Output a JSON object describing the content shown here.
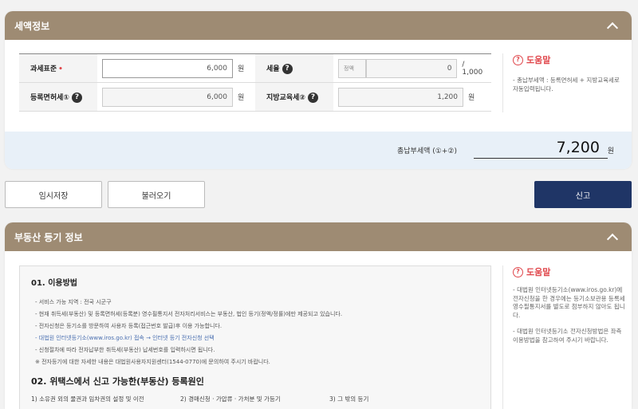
{
  "tax_panel": {
    "title": "세액정보",
    "rows": {
      "base_label": "과세표준",
      "base_required": "•",
      "base_value": "6,000",
      "base_unit": "원",
      "rate_label": "세율",
      "rate_prefix": "정액",
      "rate_value": "0",
      "rate_suffix": "/ 1,000",
      "reg_label": "등록면허세①",
      "reg_value": "6,000",
      "reg_unit": "원",
      "local_label": "지방교육세②",
      "local_value": "1,200",
      "local_unit": "원"
    },
    "help": {
      "title": "도움말",
      "text": "- 총납부세액 : 등록면허세 + 지방교육세로 자동입력됩니다."
    },
    "total": {
      "label": "총납부세액 (①+②)",
      "value": "7,200",
      "unit": "원"
    }
  },
  "actions": {
    "temp_save": "임시저장",
    "load": "불러오기",
    "submit": "신고"
  },
  "property_panel": {
    "title": "부동산 등기 정보",
    "section1_title": "01. 이용방법",
    "lines": [
      "- 서비스 가능 지역 : 전국 시군구",
      "- 현재 취득세(부동산) 및 등록면허세(등록분) 영수필통지서 전자처리서비스는 부동산, 법인 등기(정액/정률)에만 제공되고 있습니다.",
      "- 전자신청은 등기소를 방문하여 사용자 등록(접근번호 발급)후 이용 가능합니다.",
      "- 대법원 인터넷등기소(www.iros.go.kr) 접속 → 인터넷 등기 전자신청 선택",
      "- 신청절차에 따라 전자납부한 취득세(부동산) 납세번호를 입력하시면 됩니다.",
      "※ 전자등기에 대한 자세한 내용은 대법원사용자지원센터(1544-0770)에 문의하여 주시기 바랍니다."
    ],
    "section2_title": "02. 위택스에서 신고 가능한(부동산) 등록원인",
    "columns": [
      "1) 소유권 외의 물권과 임차권의 설정 및 이전",
      "2) 경매신청 · 가압류 · 가처분 및 가등기",
      "3) 그 밖의 등기"
    ],
    "help": {
      "title": "도움말",
      "text1": "- 대법원 인터넷등기소(www.iros.go.kr)에 전자신청을 한 경우에는 등기소보관용 등록세영수필통지서를 별도로 첨부하지 않아도 됩니다.",
      "text2": "- 대법원 인터넷등기소 전자신청방법은 좌측 이용방법을 참고하여 주시기 바랍니다."
    }
  },
  "colors": {
    "header": "#9e8b73",
    "primary_button": "#1f3566",
    "accent_red": "#e0474c",
    "total_bg": "#e8f0f8"
  }
}
